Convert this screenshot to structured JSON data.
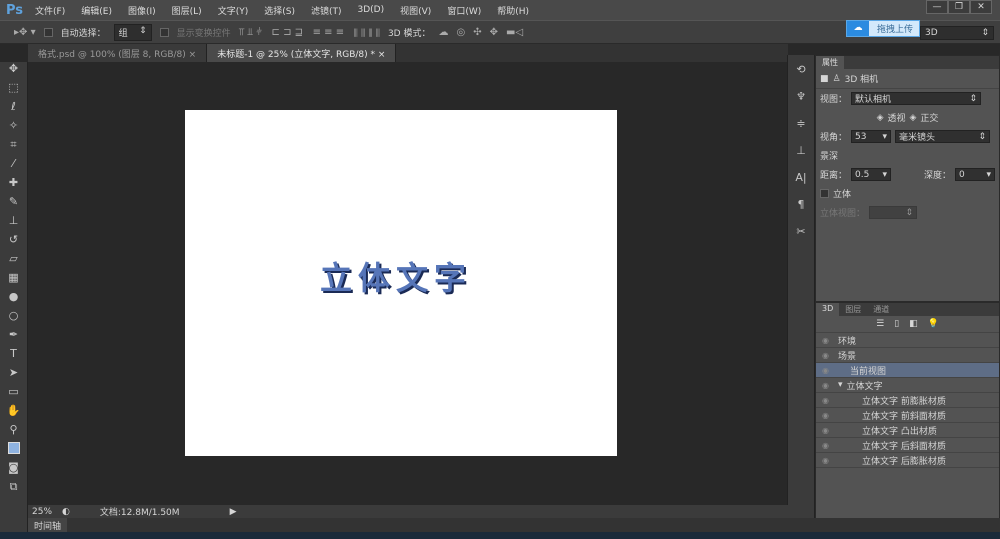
{
  "app": {
    "logo": "Ps"
  },
  "menu": [
    "文件(F)",
    "编辑(E)",
    "图像(I)",
    "图层(L)",
    "文字(Y)",
    "选择(S)",
    "滤镜(T)",
    "3D(D)",
    "视图(V)",
    "窗口(W)",
    "帮助(H)"
  ],
  "window_controls": [
    "—",
    "❐",
    "✕"
  ],
  "options": {
    "auto_select_label": "自动选择：",
    "auto_select_value": "组",
    "show_transform_label": "显示变换控件",
    "mode_3d_label": "3D 模式：",
    "workspace": "3D"
  },
  "upload": {
    "label": "拖拽上传"
  },
  "tabs": [
    {
      "label": "格式.psd @ 100% (图层 8, RGB/8)",
      "close": "×"
    },
    {
      "label": "未标题-1 @ 25% (立体文字, RGB/8) *",
      "close": "×"
    }
  ],
  "canvas": {
    "text": "立体文字"
  },
  "properties": {
    "tab": "属性",
    "title": "3D 相机",
    "view_label": "视图：",
    "view_value": "默认相机",
    "perspective": "透视",
    "ortho": "正交",
    "fov_label": "视角：",
    "fov_value": "53",
    "lens_value": "毫米镜头",
    "dof_label": "景深",
    "distance_label": "距离：",
    "distance_value": "0.5",
    "depth_label": "深度：",
    "depth_value": "0",
    "stereo_label": "立体",
    "stereo_view_label": "立体视图："
  },
  "panel3d": {
    "tabs": [
      "3D",
      "图层",
      "通道"
    ],
    "items": [
      "环境",
      "场景",
      "当前视图",
      "立体文字",
      "立体文字 前膨胀材质",
      "立体文字 前斜面材质",
      "立体文字 凸出材质",
      "立体文字 后斜面材质",
      "立体文字 后膨胀材质"
    ]
  },
  "status": {
    "zoom": "25%",
    "doc": "文档:12.8M/1.50M"
  },
  "timeline": {
    "label": "时间轴"
  },
  "colors": {
    "accent": "#5675b8",
    "selected_row": "#5e6d86"
  }
}
